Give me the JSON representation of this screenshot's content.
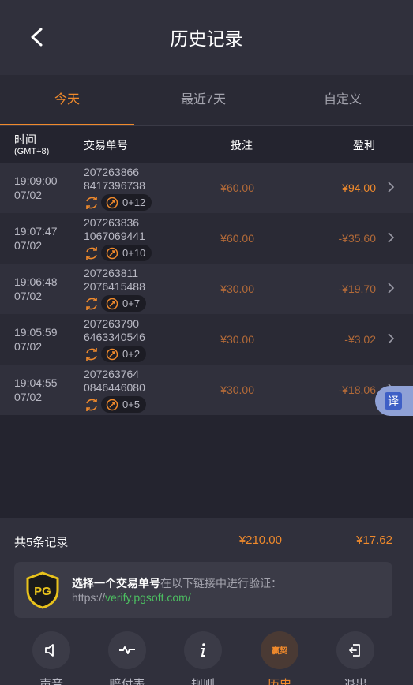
{
  "header": {
    "title": "历史记录"
  },
  "tabs": [
    {
      "label": "今天",
      "active": true
    },
    {
      "label": "最近7天",
      "active": false
    },
    {
      "label": "自定义",
      "active": false
    }
  ],
  "columns": {
    "time": "时间",
    "tz": "(GMT+8)",
    "id": "交易单号",
    "bet": "投注",
    "profit": "盈利"
  },
  "rows": [
    {
      "time": "19:09:00",
      "date": "07/02",
      "id1": "207263866",
      "id2": "8417396738",
      "spins": "0+12",
      "bet": "¥60.00",
      "profit": "¥94.00"
    },
    {
      "time": "19:07:47",
      "date": "07/02",
      "id1": "207263836",
      "id2": "1067069441",
      "spins": "0+10",
      "bet": "¥60.00",
      "profit": "-¥35.60"
    },
    {
      "time": "19:06:48",
      "date": "07/02",
      "id1": "207263811",
      "id2": "2076415488",
      "spins": "0+7",
      "bet": "¥30.00",
      "profit": "-¥19.70"
    },
    {
      "time": "19:05:59",
      "date": "07/02",
      "id1": "207263790",
      "id2": "6463340546",
      "spins": "0+2",
      "bet": "¥30.00",
      "profit": "-¥3.02"
    },
    {
      "time": "19:04:55",
      "date": "07/02",
      "id1": "207263764",
      "id2": "0846446080",
      "spins": "0+5",
      "bet": "¥30.00",
      "profit": "-¥18.06"
    }
  ],
  "translate": {
    "label": "译"
  },
  "summary": {
    "label": "共5条记录",
    "total_bet": "¥210.00",
    "total_profit": "¥17.62"
  },
  "verify": {
    "bold": "选择一个交易单号",
    "rest": "在以下链接中进行验证：",
    "url_prefix": "https://",
    "url_link": "verify.pgsoft.com/",
    "logo_text": "PG"
  },
  "nav": [
    {
      "label": "声音",
      "icon": "speaker-icon",
      "active": false
    },
    {
      "label": "赔付表",
      "icon": "pulse-icon",
      "active": false
    },
    {
      "label": "规则",
      "icon": "info-icon",
      "active": false
    },
    {
      "label": "历史",
      "icon": "history-icon",
      "active": true,
      "badge": "赢契"
    },
    {
      "label": "退出",
      "icon": "exit-icon",
      "active": false
    }
  ],
  "colors": {
    "accent": "#f08a2c",
    "negative": "#b36a38",
    "link": "#4cc061",
    "background": "#24242f"
  }
}
